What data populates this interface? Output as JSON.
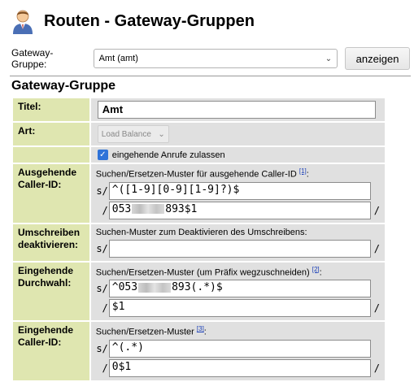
{
  "header": {
    "title": "Routen - Gateway-Gruppen",
    "icon": "user-avatar-icon"
  },
  "gateway_select": {
    "label": "Gateway-Gruppe:",
    "value": "Amt (amt)",
    "button": "anzeigen"
  },
  "section": {
    "title": "Gateway-Gruppe"
  },
  "form": {
    "titel": {
      "label": "Titel:",
      "value": "Amt"
    },
    "art": {
      "label": "Art:",
      "value": "Load Balance"
    },
    "incoming": {
      "label": "eingehende Anrufe zulassen",
      "checked": true
    },
    "ausgehende": {
      "label": "Ausgehende Caller-ID:",
      "hint": "Suchen/Ersetzen-Muster für ausgehende Caller-ID",
      "ref": "[1]",
      "search_prefix": "s/",
      "search": "^([1-9][0-9][1-9]?)$",
      "replace_prefix": "/",
      "replace_a": "053",
      "replace_b": "893$1",
      "suffix": "/"
    },
    "umschreiben": {
      "label": "Umschreiben deaktivieren:",
      "hint": "Suchen-Muster zum Deaktivieren des Umschreibens:",
      "search_prefix": "s/",
      "search": "",
      "suffix": "/"
    },
    "durchwahl": {
      "label": "Eingehende Durchwahl:",
      "hint": "Suchen/Ersetzen-Muster (um Präfix wegzuschneiden)",
      "ref": "[2]",
      "search_prefix": "s/",
      "search_a": "^053",
      "search_b": "893(.*)$",
      "replace_prefix": "/",
      "replace": "$1",
      "suffix": "/"
    },
    "eingehende_cid": {
      "label": "Eingehende Caller-ID:",
      "hint": "Suchen/Ersetzen-Muster",
      "ref": "[3]",
      "search_prefix": "s/",
      "search": "^(.*)",
      "replace_prefix": "/",
      "replace": "0$1",
      "suffix": "/"
    }
  }
}
